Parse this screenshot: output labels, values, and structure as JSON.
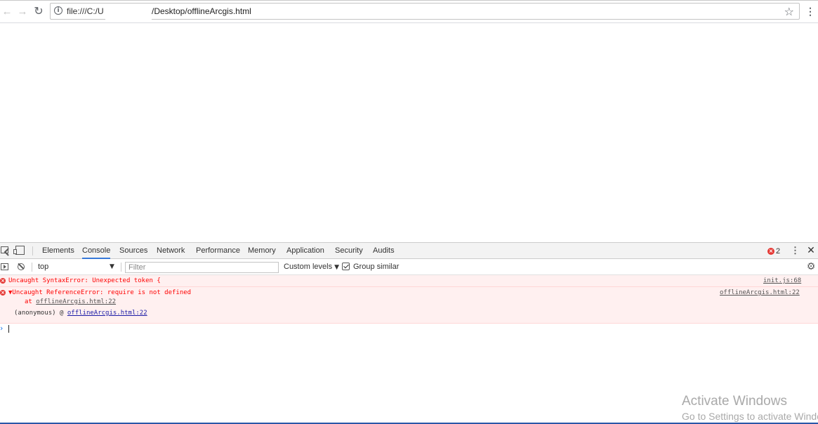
{
  "browser": {
    "back_icon": "arrow-left-icon",
    "forward_icon": "arrow-right-icon",
    "reload_icon": "reload-icon",
    "url_prefix": "file:///C:/U",
    "url_suffix": "/Desktop/offlineArcgis.html",
    "info_glyph": "i",
    "star_icon": "star-icon",
    "menu_icon": "three-dots-vertical-icon"
  },
  "devtools": {
    "tabs": [
      {
        "label": "Elements"
      },
      {
        "label": "Console",
        "active": true
      },
      {
        "label": "Sources"
      },
      {
        "label": "Network"
      },
      {
        "label": "Performance"
      },
      {
        "label": "Memory"
      },
      {
        "label": "Application"
      },
      {
        "label": "Security"
      },
      {
        "label": "Audits"
      }
    ],
    "error_count": "2",
    "filter_bar": {
      "context": "top",
      "filter_placeholder": "Filter",
      "levels_label": "Custom levels",
      "group_similar_label": "Group similar",
      "group_similar_checked": true
    },
    "messages": [
      {
        "text": "Uncaught SyntaxError: Unexpected token {",
        "source": "init.js:68"
      },
      {
        "text": "▼Uncaught ReferenceError: require is not defined",
        "source": "offlineArcgis.html:22",
        "stack_prefix": "at ",
        "stack_link": "offlineArcgis.html:22",
        "anon_prefix": "(anonymous) @ ",
        "anon_link": "offlineArcgis.html:22"
      }
    ],
    "prompt_symbol": "›"
  },
  "watermark": {
    "title": "Activate Windows",
    "subtitle": "Go to Settings to activate Windows."
  },
  "colors": {
    "error_red": "#ff0000",
    "error_bg": "#fff0f0",
    "active_tab_underline": "#3879d9",
    "link_blue": "#1a1aa6"
  }
}
